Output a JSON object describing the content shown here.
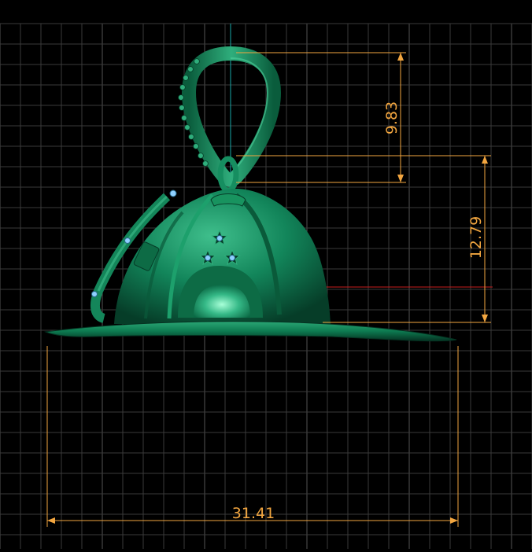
{
  "viewport": {
    "background": "#000000",
    "grid_color": "#3a3a3a",
    "grid_major_color": "#555555"
  },
  "model": {
    "body_color": "#0e7a52",
    "body_light_color": "#2fae7c",
    "body_dark_color": "#063d28",
    "gem_color": "#8fd0ff"
  },
  "dimensions": {
    "color": "#f2a640",
    "bail_height": "9.83",
    "helmet_height": "12.79",
    "overall_width": "31.41"
  },
  "axes": {
    "vertical_color": "#18a8a8",
    "horizontal_color": "#c81e1e"
  }
}
